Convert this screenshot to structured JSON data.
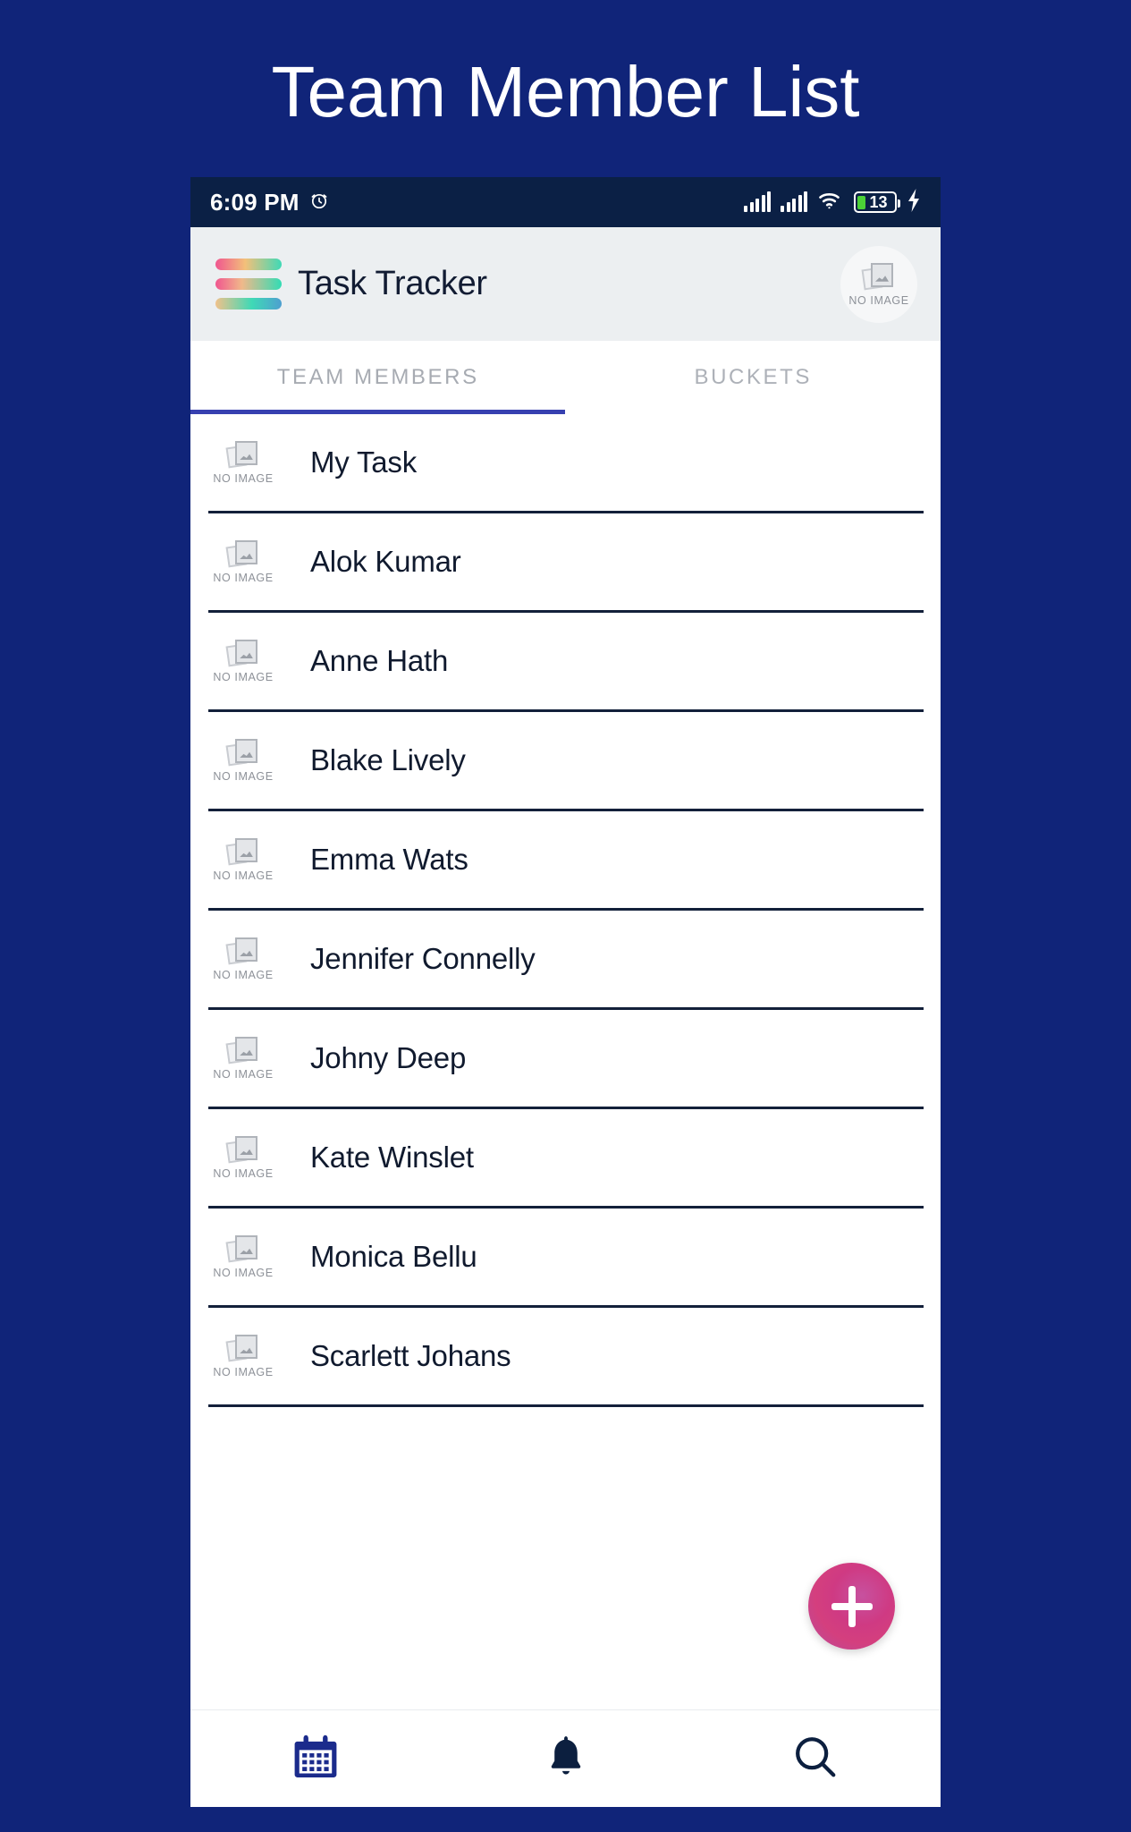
{
  "page": {
    "heading": "Team Member List",
    "background_color": "#102479"
  },
  "status_bar": {
    "time": "6:09 PM",
    "alarm_icon": "alarm-clock-icon",
    "signal_1_icon": "cellular-signal-icon",
    "signal_2_icon": "cellular-signal-icon",
    "wifi_icon": "wifi-icon",
    "battery_level": "13",
    "charging_icon": "lightning-bolt-icon",
    "background_color": "#0b2045"
  },
  "app_bar": {
    "logo_icon": "task-tracker-logo-icon",
    "title": "Task Tracker",
    "avatar_caption": "NO IMAGE",
    "background_color": "#eceff1"
  },
  "tabs": {
    "items": [
      {
        "label": "TEAM MEMBERS",
        "active": true
      },
      {
        "label": "BUCKETS",
        "active": false
      }
    ],
    "indicator_color": "#3740b0"
  },
  "member_list": {
    "placeholder_caption": "NO IMAGE",
    "items": [
      {
        "name": "My Task"
      },
      {
        "name": "Alok Kumar"
      },
      {
        "name": "Anne Hath"
      },
      {
        "name": "Blake Lively"
      },
      {
        "name": "Emma Wats"
      },
      {
        "name": "Jennifer Connelly"
      },
      {
        "name": "Johny Deep"
      },
      {
        "name": "Kate Winslet"
      },
      {
        "name": "Monica Bellu"
      },
      {
        "name": "Scarlett Johans"
      }
    ]
  },
  "fab": {
    "label": "+",
    "icon": "plus-icon",
    "color": "#cf3a83"
  },
  "bottom_nav": {
    "items": [
      {
        "icon": "calendar-icon",
        "active": true,
        "color": "#1b2b8c"
      },
      {
        "icon": "bell-icon",
        "active": false,
        "color": "#0c1f3f"
      },
      {
        "icon": "search-icon",
        "active": false,
        "color": "#0c1f3f"
      }
    ]
  }
}
